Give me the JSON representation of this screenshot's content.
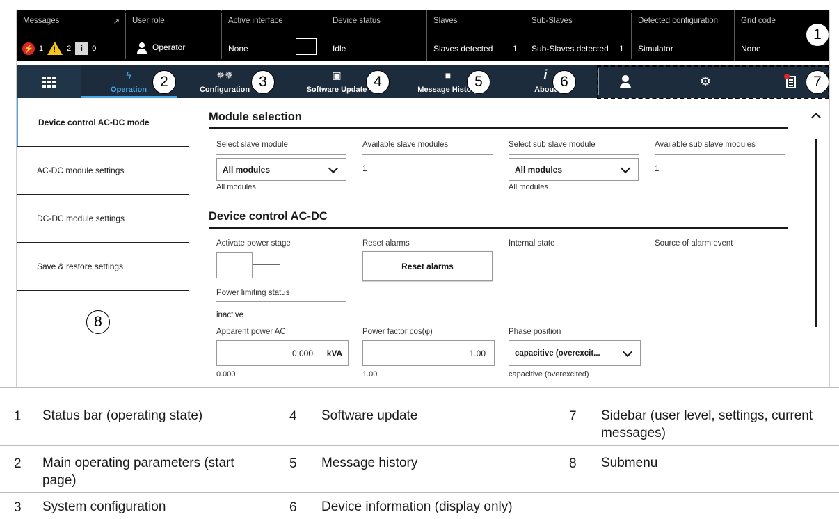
{
  "status_bar": {
    "messages": {
      "label": "Messages",
      "errors": "1",
      "warnings": "2",
      "infos": "0"
    },
    "user_role": {
      "label": "User role",
      "value": "Operator"
    },
    "active_interface": {
      "label": "Active interface",
      "value": "None"
    },
    "device_status": {
      "label": "Device status",
      "value": "Idle"
    },
    "slaves": {
      "label": "Slaves",
      "value": "Slaves detected",
      "count": "1"
    },
    "sub_slaves": {
      "label": "Sub-Slaves",
      "value": "Sub-Slaves detected",
      "count": "1"
    },
    "detected_configuration": {
      "label": "Detected configuration",
      "value": "Simulator"
    },
    "grid_code": {
      "label": "Grid code",
      "value": "None"
    }
  },
  "nav": {
    "tabs": [
      {
        "label": "Operation",
        "icon": "lightning-icon",
        "active": true
      },
      {
        "label": "Configuration",
        "icon": "gears-icon"
      },
      {
        "label": "Software Update",
        "icon": "upload-icon"
      },
      {
        "label": "Message History",
        "icon": "book-icon"
      },
      {
        "label": "About",
        "icon": "info-icon"
      }
    ],
    "side_icons": [
      "user-icon",
      "gear-icon",
      "clipboard-icon"
    ]
  },
  "submenu": {
    "items": [
      {
        "label": "Device control AC-DC mode",
        "active": true
      },
      {
        "label": "AC-DC module settings"
      },
      {
        "label": "DC-DC module settings"
      },
      {
        "label": "Save & restore settings"
      }
    ]
  },
  "main": {
    "module_selection": {
      "title": "Module selection",
      "select_slave_label": "Select slave module",
      "select_slave_value": "All modules",
      "select_slave_sub": "All modules",
      "available_slave_label": "Available slave modules",
      "available_slave_value": "1",
      "select_sub_slave_label": "Select sub slave module",
      "select_sub_slave_value": "All modules",
      "select_sub_slave_sub": "All modules",
      "available_sub_slave_label": "Available sub slave modules",
      "available_sub_slave_value": "1"
    },
    "device_control": {
      "title": "Device control AC-DC",
      "activate_power_label": "Activate power stage",
      "reset_alarms_label": "Reset alarms",
      "reset_alarms_button": "Reset alarms",
      "internal_state_label": "Internal state",
      "source_alarm_label": "Source of alarm event",
      "power_limiting_label": "Power limiting status",
      "power_limiting_value": "inactive",
      "apparent_power_label": "Apparent power AC",
      "apparent_power_value": "0.000",
      "apparent_power_unit": "kVA",
      "apparent_power_sub": "0.000",
      "power_factor_label": "Power factor cos(φ)",
      "power_factor_value": "1.00",
      "power_factor_sub": "1.00",
      "phase_position_label": "Phase position",
      "phase_position_value": "capacitive (overexcit...",
      "phase_position_sub": "capacitive (overexcited)"
    }
  },
  "callouts": [
    "1",
    "2",
    "3",
    "4",
    "5",
    "6",
    "7",
    "8"
  ],
  "legend": [
    {
      "num": "1",
      "text": "Status bar (operating state)"
    },
    {
      "num": "2",
      "text": "Main operating parameters (start page)"
    },
    {
      "num": "3",
      "text": "System configuration"
    },
    {
      "num": "4",
      "text": "Software update"
    },
    {
      "num": "5",
      "text": "Message history"
    },
    {
      "num": "6",
      "text": "Device information (display only)"
    },
    {
      "num": "7",
      "text": "Sidebar (user level, settings, current messages)"
    },
    {
      "num": "8",
      "text": "Submenu"
    }
  ]
}
